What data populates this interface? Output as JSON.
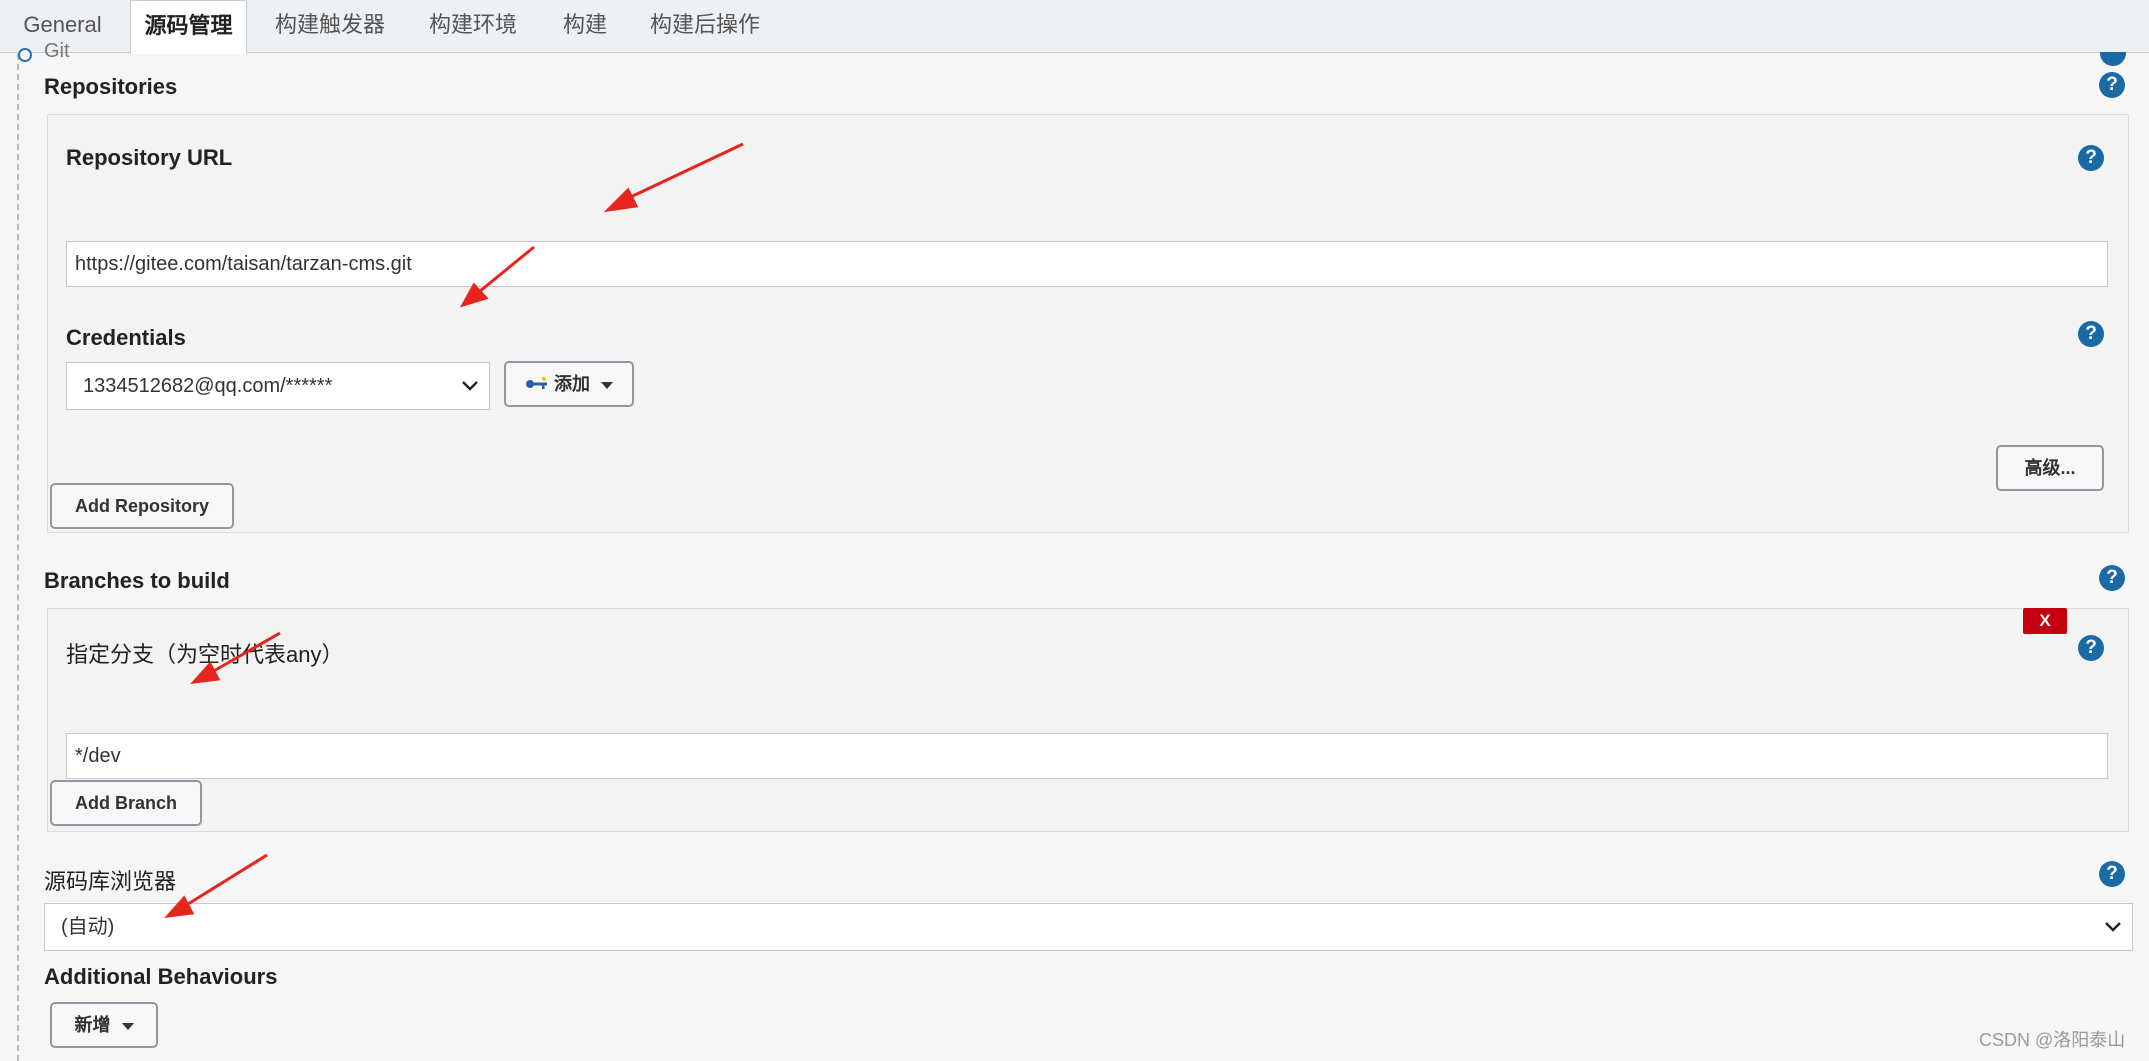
{
  "tabs": [
    {
      "label": "General"
    },
    {
      "label": "源码管理"
    },
    {
      "label": "构建触发器"
    },
    {
      "label": "构建环境"
    },
    {
      "label": "构建"
    },
    {
      "label": "构建后操作"
    }
  ],
  "scm": {
    "git_label": "Git",
    "repositories_label": "Repositories",
    "repository_url_label": "Repository URL",
    "repository_url_value": "https://gitee.com/taisan/tarzan-cms.git",
    "credentials_label": "Credentials",
    "credentials_value": "1334512682@qq.com/******",
    "add_credentials_label": "添加",
    "advanced_label": "高级...",
    "add_repository_label": "Add Repository",
    "branches_label": "Branches to build",
    "delete_label": "X",
    "branch_specifier_label": "指定分支（为空时代表any）",
    "branch_value": "*/dev",
    "add_branch_label": "Add Branch",
    "repo_browser_label": "源码库浏览器",
    "repo_browser_value": "(自动)",
    "additional_behaviours_label": "Additional Behaviours",
    "add_behaviour_label": "新增"
  },
  "help_icon_text": "?",
  "watermark": "CSDN @洛阳泰山",
  "colors": {
    "help_icon": "#1a6aa6",
    "delete_button": "#c40010",
    "annotation_arrow": "#e8251d"
  },
  "icons": [
    "key-icon",
    "help-icon",
    "chevron-down-icon",
    "caret-down-icon"
  ]
}
